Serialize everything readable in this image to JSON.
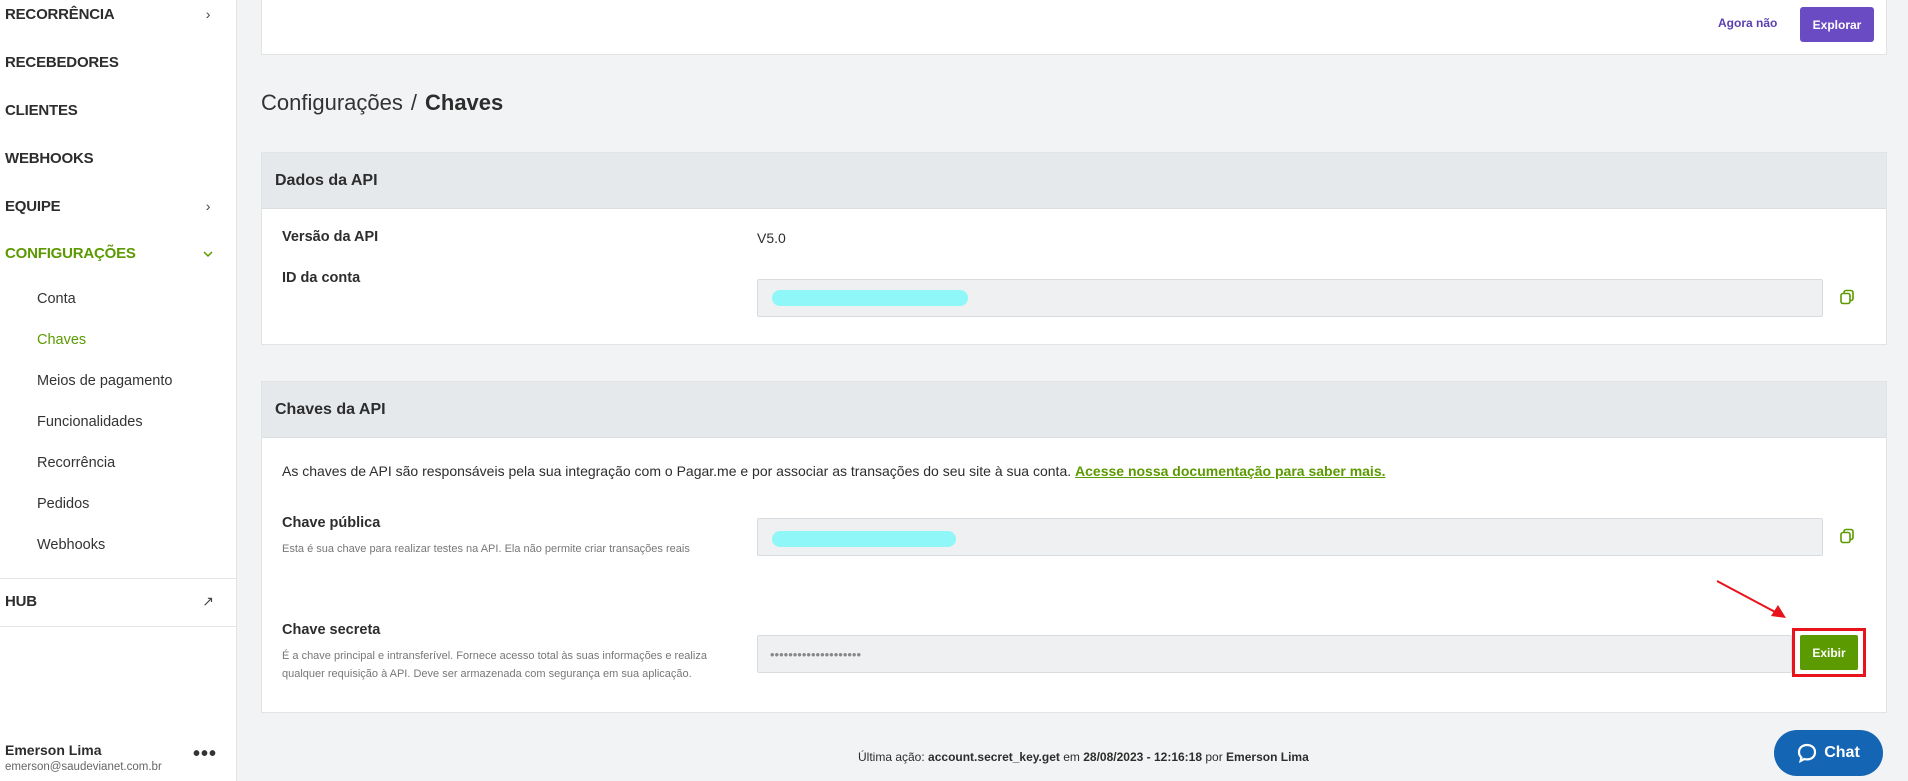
{
  "sidebar": {
    "items": [
      {
        "label": "RECORRÊNCIA",
        "has_chevron": true
      },
      {
        "label": "RECEBEDORES"
      },
      {
        "label": "CLIENTES"
      },
      {
        "label": "WEBHOOKS"
      },
      {
        "label": "EQUIPE",
        "has_chevron": true
      },
      {
        "label": "CONFIGURAÇÕES",
        "expanded": true,
        "active": true
      }
    ],
    "chevron_right": "›",
    "chevron_down": "⌄",
    "sub_items": [
      "Conta",
      "Chaves",
      "Meios de pagamento",
      "Funcionalidades",
      "Recorrência",
      "Pedidos",
      "Webhooks"
    ],
    "active_sub_item": "Chaves",
    "hub": {
      "label": "HUB",
      "icon": "external-arrow-icon",
      "glyph": "↗"
    },
    "user": {
      "name": "Emerson Lima",
      "email": "emerson@saudevianet.com.br",
      "more_glyph": "•••"
    }
  },
  "banner": {
    "later_label": "Agora não",
    "explore_label": "Explorar"
  },
  "breadcrumb": {
    "parent": "Configurações",
    "separator": "/",
    "current": "Chaves"
  },
  "api_data": {
    "title": "Dados da API",
    "version_label": "Versão da API",
    "version_value": "V5.0",
    "account_id_label": "ID da conta"
  },
  "api_keys": {
    "title": "Chaves da API",
    "intro": "As chaves de API são responsáveis pela sua integração com o Pagar.me e por associar as transações do seu site à sua conta.",
    "intro_link": "Acesse nossa documentação para saber mais.",
    "public_key_label": "Chave pública",
    "public_key_desc": "Esta é sua chave para realizar testes na API. Ela não permite criar transações reais",
    "secret_key_label": "Chave secreta",
    "secret_key_desc": "É a chave principal e intransferível. Fornece acesso total às suas informações e realiza qualquer requisição à API. Deve ser armazenada com segurança em sua aplicação.",
    "secret_key_masked": "••••••••••••••••••••",
    "show_label": "Exibir"
  },
  "footer": {
    "prefix": "Última ação:",
    "action": "account.secret_key.get",
    "on": "em",
    "datetime": "28/08/2023 - 12:16:18",
    "by": "por",
    "user": "Emerson Lima"
  },
  "chat": {
    "label": "Chat"
  },
  "colors": {
    "accent_green": "#5b9a00",
    "purple": "#6a4bc4",
    "highlight_red": "#e8141c",
    "chat_blue": "#1565b5"
  }
}
